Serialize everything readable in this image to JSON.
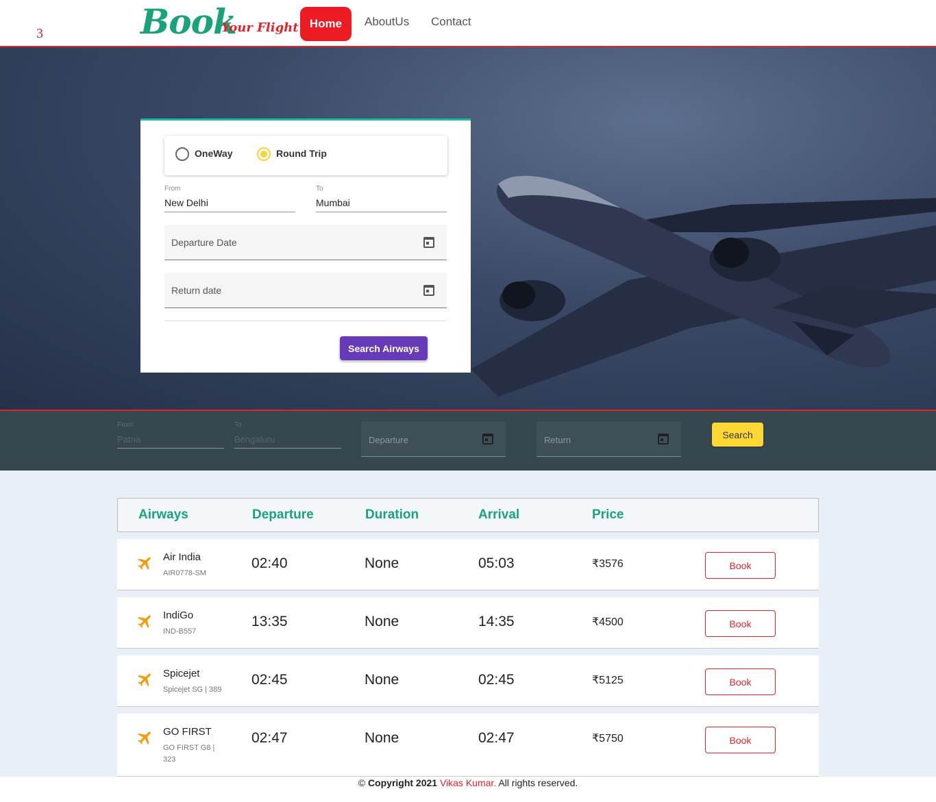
{
  "corner_number": "3",
  "brand": {
    "book": "Book",
    "sub": "Your Flight"
  },
  "nav": {
    "home": "Home",
    "about": "AboutUs",
    "contact": "Contact"
  },
  "search_card": {
    "trip_types": [
      {
        "label": "OneWay",
        "selected": false
      },
      {
        "label": "Round Trip",
        "selected": true
      }
    ],
    "from_label": "From",
    "from_value": "New Delhi",
    "to_label": "To",
    "to_value": "Mumbai",
    "departure_placeholder": "Departure Date",
    "return_placeholder": "Return date",
    "search_label": "Search Airways"
  },
  "quick_search": {
    "from_label": "From",
    "from_placeholder": "Patna",
    "to_label": "To",
    "to_placeholder": "Bengaluru",
    "departure_placeholder": "Departure",
    "return_placeholder": "Return",
    "search_label": "Search"
  },
  "results": {
    "headers": [
      "Airways",
      "Departure",
      "Duration",
      "Arrival",
      "Price"
    ],
    "rows": [
      {
        "airline": "Air India",
        "code": "AIR0778-SM",
        "departure": "02:40",
        "duration": "None",
        "arrival": "05:03",
        "price": "₹3576",
        "action": "Book"
      },
      {
        "airline": "IndiGo",
        "code": "IND-B557",
        "departure": "13:35",
        "duration": "None",
        "arrival": "14:35",
        "price": "₹4500",
        "action": "Book"
      },
      {
        "airline": "Spicejet",
        "code": "Spicejet SG | 389",
        "departure": "02:45",
        "duration": "None",
        "arrival": "02:45",
        "price": "₹5125",
        "action": "Book"
      },
      {
        "airline": "GO FIRST",
        "code": "GO FIRST G8 | 323",
        "departure": "02:47",
        "duration": "None",
        "arrival": "02:47",
        "price": "₹5750",
        "action": "Book"
      }
    ]
  },
  "footer": {
    "symbol": "©",
    "copyright": "Copyright 2021",
    "author": "Vikas Kumar.",
    "rights": "All rights reserved."
  },
  "colors": {
    "brand_green": "#1aa37a",
    "brand_red": "#e0242c",
    "primary_purple": "#673ab7",
    "accent_yellow": "#fdd835"
  }
}
